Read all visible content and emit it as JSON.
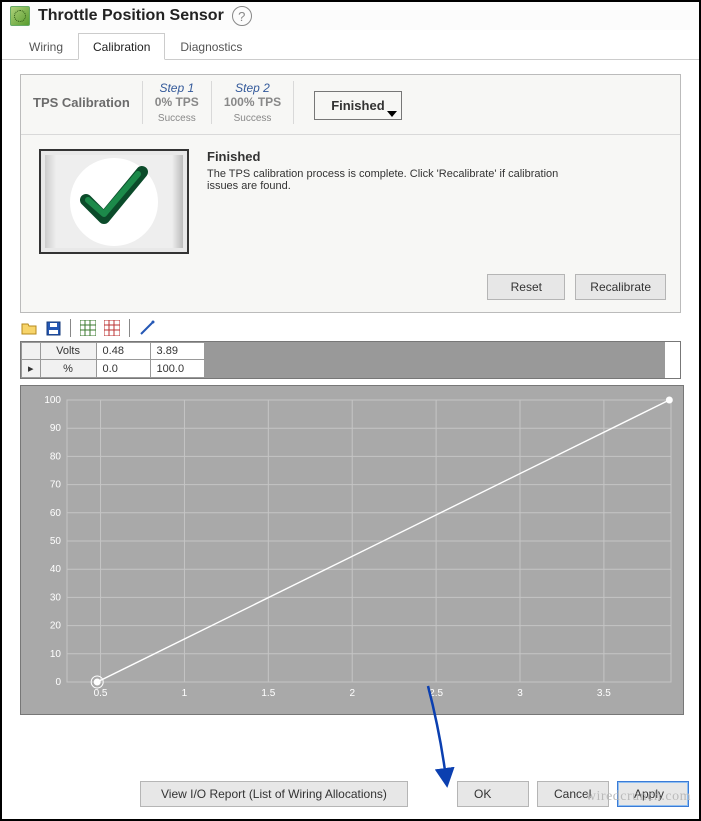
{
  "header": {
    "title": "Throttle Position Sensor"
  },
  "tabs": [
    {
      "label": "Wiring",
      "active": false
    },
    {
      "label": "Calibration",
      "active": true
    },
    {
      "label": "Diagnostics",
      "active": false
    }
  ],
  "stepper": {
    "title": "TPS Calibration",
    "step1": {
      "num": "Step 1",
      "value": "0% TPS",
      "status": "Success"
    },
    "step2": {
      "num": "Step 2",
      "value": "100% TPS",
      "status": "Success"
    },
    "finished_pill": "Finished"
  },
  "finished": {
    "heading": "Finished",
    "body": "The TPS calibration process is complete. Click 'Recalibrate' if calibration issues are found."
  },
  "buttons": {
    "reset": "Reset",
    "recalibrate": "Recalibrate",
    "io_report": "View I/O Report (List of Wiring Allocations)",
    "ok": "OK",
    "cancel": "Cancel",
    "apply": "Apply"
  },
  "grid": {
    "rows": [
      {
        "label": "Volts",
        "a": "0.48",
        "b": "3.89"
      },
      {
        "label": "%",
        "a": "0.0",
        "b": "100.0"
      }
    ],
    "cursor_row": 1
  },
  "chart_data": {
    "type": "line",
    "x": [
      0.48,
      3.89
    ],
    "y": [
      0.0,
      100.0
    ],
    "xlabel": "",
    "ylabel": "",
    "xlim": [
      0.3,
      3.9
    ],
    "ylim": [
      0,
      100
    ],
    "xticks": [
      0.5,
      1,
      1.5,
      2,
      2.5,
      3,
      3.5
    ],
    "yticks": [
      0,
      10,
      20,
      30,
      40,
      50,
      60,
      70,
      80,
      90,
      100
    ],
    "grid": true
  },
  "watermark": "wiredcrunch.com"
}
